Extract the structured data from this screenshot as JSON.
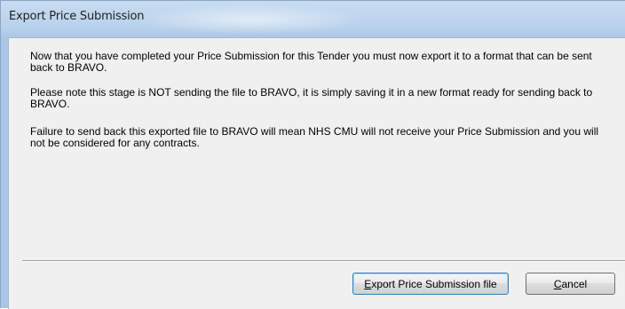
{
  "window": {
    "title": "Export Price Submission"
  },
  "message": {
    "paragraph1": "Now that you have completed your Price Submission for this Tender you must now export it to a format that can be sent back to BRAVO.",
    "paragraph2": "Please note this stage is NOT sending the file to BRAVO, it is simply saving it in a new format ready for sending back to BRAVO.",
    "paragraph3": "Failure to send back this exported file to BRAVO will mean NHS CMU will not receive your Price Submission and you will not be considered for any contracts."
  },
  "buttons": {
    "export": {
      "mnemonic": "E",
      "rest": "xport Price Submission file"
    },
    "cancel": {
      "mnemonic": "C",
      "rest": "ancel"
    }
  }
}
